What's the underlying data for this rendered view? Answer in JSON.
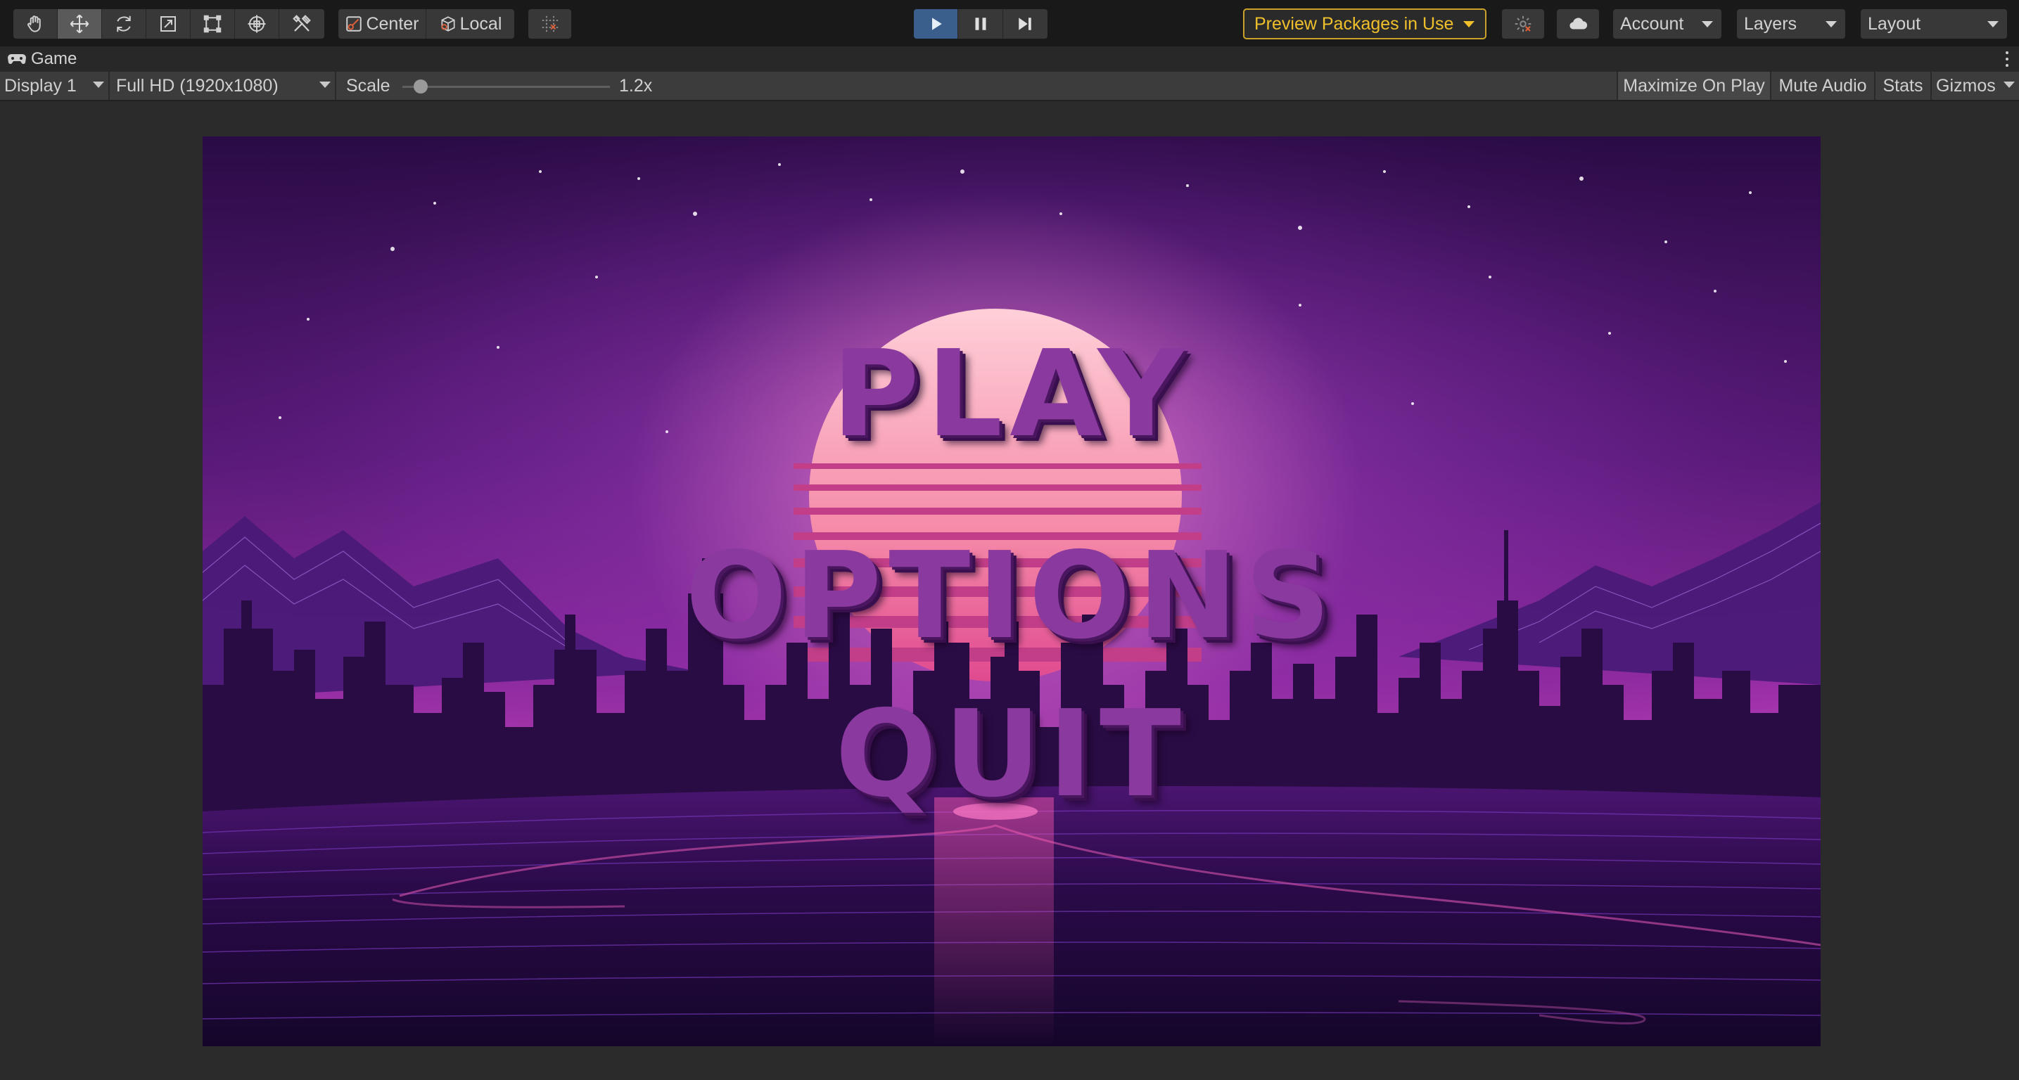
{
  "toolbar": {
    "tools": [
      {
        "icon": "hand-tool-icon"
      },
      {
        "icon": "move-tool-icon",
        "active": true
      },
      {
        "icon": "rotate-tool-icon"
      },
      {
        "icon": "scale-tool-icon"
      },
      {
        "icon": "rect-tool-icon"
      },
      {
        "icon": "transform-tool-icon"
      },
      {
        "icon": "custom-tools-icon"
      }
    ],
    "pivot_mode": "Center",
    "pivot_rotation": "Local",
    "grid_snap_icon": "grid-snap-icon",
    "play_icon": "play-icon",
    "pause_icon": "pause-icon",
    "step_icon": "step-icon",
    "preview_packages_label": "Preview Packages in Use",
    "preview_packages_color": "#f0c02c",
    "collab_icon": "collab-icon",
    "cloud_icon": "cloud-icon",
    "account_label": "Account",
    "layers_label": "Layers",
    "layout_label": "Layout",
    "play_accent": "#3a5f8c"
  },
  "tab": {
    "icon": "gamepad-icon",
    "label": "Game"
  },
  "game_toolbar": {
    "display": "Display 1",
    "resolution": "Full HD (1920x1080)",
    "scale_label": "Scale",
    "scale_value": "1.2x",
    "scale_slider_fraction": 0.06,
    "maximize_on_play": "Maximize On Play",
    "mute_audio": "Mute Audio",
    "stats": "Stats",
    "gizmos": "Gizmos"
  },
  "game_menu": {
    "play": "PLAY",
    "options": "OPTIONS",
    "quit": "QUIT",
    "button_color": "#8a3a9e"
  }
}
